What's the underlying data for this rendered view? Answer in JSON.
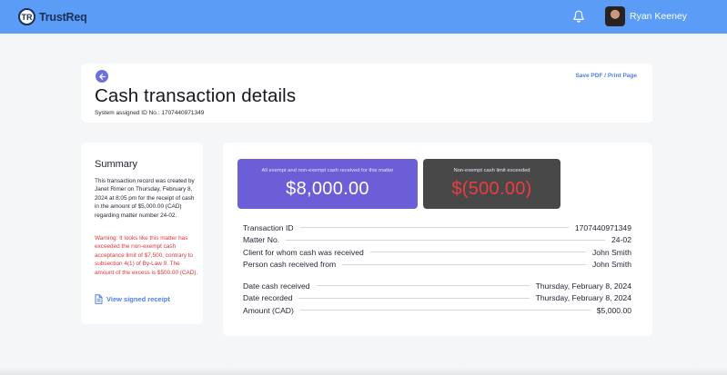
{
  "header": {
    "brand_initials": "TR",
    "brand_name": "TrustReq",
    "user_name": "Ryan Keeney"
  },
  "page": {
    "title": "Cash transaction details",
    "system_id_label": "System assigned ID No.: 1707440971349",
    "save_link": "Save PDF / Print Page"
  },
  "summary": {
    "title": "Summary",
    "text": "This transaction record was created by Janet Rimer on Thursday, February 8, 2024 at 8:05 pm for the receipt of cash in the amount of $5,000.00 (CAD) regarding matter number 24-02.",
    "warning": "Warning: It looks like this matter has exceeded the non-exempt cash acceptance limit of $7,500, contrary to subsection 4(1) of By-Law 9. The amount of the excess is $500.00 (CAD).",
    "receipt_link": "View signed receipt"
  },
  "stats": {
    "total_caption": "All exempt and non-exempt cash received for this matter",
    "total_value": "$8,000.00",
    "exceeded_caption": "Non-exempt cash limit exceeded",
    "exceeded_value": "$(500.00)"
  },
  "details": {
    "group_a": [
      {
        "label": "Transaction ID",
        "value": "1707440971349"
      },
      {
        "label": "Matter No.",
        "value": "24-02"
      },
      {
        "label": "Client for whom cash was received",
        "value": "John Smith"
      },
      {
        "label": "Person cash received from",
        "value": "John Smith"
      }
    ],
    "group_b": [
      {
        "label": "Date cash received",
        "value": "Thursday, February 8, 2024"
      },
      {
        "label": "Date recorded",
        "value": "Thursday, February 8, 2024"
      },
      {
        "label": "Amount (CAD)",
        "value": "$5,000.00"
      }
    ]
  },
  "colors": {
    "topbar": "#5b9cf6",
    "accent_purple": "#6b5ed6",
    "dark_box": "#484848",
    "warning_red": "#e0353a",
    "link_blue": "#4f7ee8"
  }
}
